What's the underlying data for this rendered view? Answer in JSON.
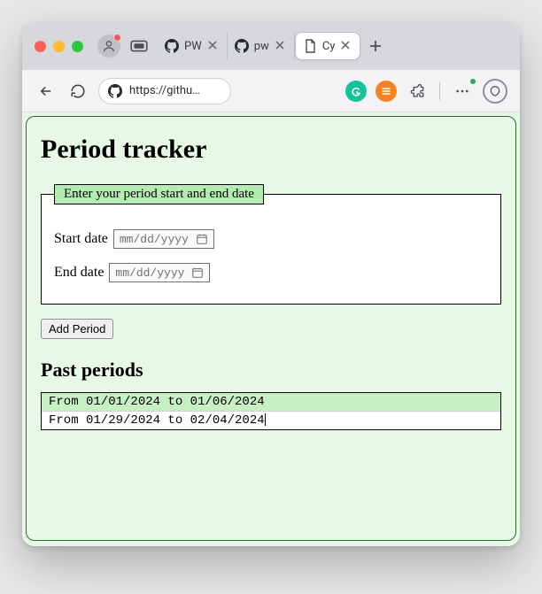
{
  "browser": {
    "tabs": [
      {
        "title": "PW",
        "icon": "github"
      },
      {
        "title": "pw",
        "icon": "github"
      },
      {
        "title": "Cy",
        "icon": "document",
        "active": true
      }
    ],
    "url": "https://githu…"
  },
  "app": {
    "heading": "Period tracker",
    "fieldset_legend": "Enter your period start and end date",
    "start_label": "Start date",
    "end_label": "End date",
    "placeholder": "mm/dd/yyyy",
    "add_button": "Add Period",
    "past_heading": "Past periods",
    "past": [
      "From 01/01/2024 to 01/06/2024",
      "From 01/29/2024 to 02/04/2024"
    ]
  }
}
